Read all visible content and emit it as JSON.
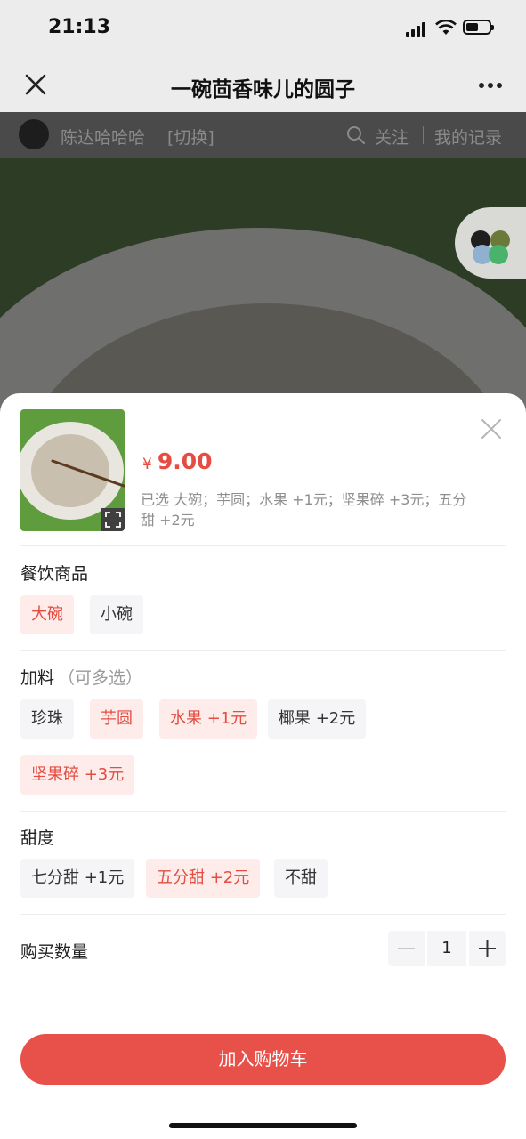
{
  "status_bar": {
    "time": "21:13"
  },
  "nav": {
    "title": "一碗茴香味儿的圆子"
  },
  "page": {
    "user_name": "陈达哈哈哈",
    "switch_label": "[切换]",
    "follow_label": "关注",
    "records_label": "我的记录"
  },
  "sheet": {
    "price_symbol": "¥",
    "price": "9.00",
    "selected_summary": "已选 大碗；芋圆；水果 +1元；坚果碎 +3元；五分甜 +2元",
    "sections": {
      "product": {
        "label": "餐饮商品",
        "options": [
          {
            "label": "大碗",
            "selected": true
          },
          {
            "label": "小碗",
            "selected": false
          }
        ]
      },
      "toppings": {
        "label": "加料",
        "hint": "（可多选）",
        "options": [
          {
            "label": "珍珠",
            "selected": false
          },
          {
            "label": "芋圆",
            "selected": true
          },
          {
            "label": "水果 +1元",
            "selected": true
          },
          {
            "label": "椰果 +2元",
            "selected": false
          },
          {
            "label": "坚果碎 +3元",
            "selected": true
          }
        ]
      },
      "sweetness": {
        "label": "甜度",
        "options": [
          {
            "label": "七分甜 +1元",
            "selected": false
          },
          {
            "label": "五分甜 +2元",
            "selected": true
          },
          {
            "label": "不甜",
            "selected": false
          }
        ]
      }
    },
    "quantity": {
      "label": "购买数量",
      "value": "1"
    },
    "add_to_cart_label": "加入购物车"
  },
  "colors": {
    "accent": "#e54d42",
    "chip_active_bg": "#fdecea",
    "chip_bg": "#f5f5f7"
  }
}
